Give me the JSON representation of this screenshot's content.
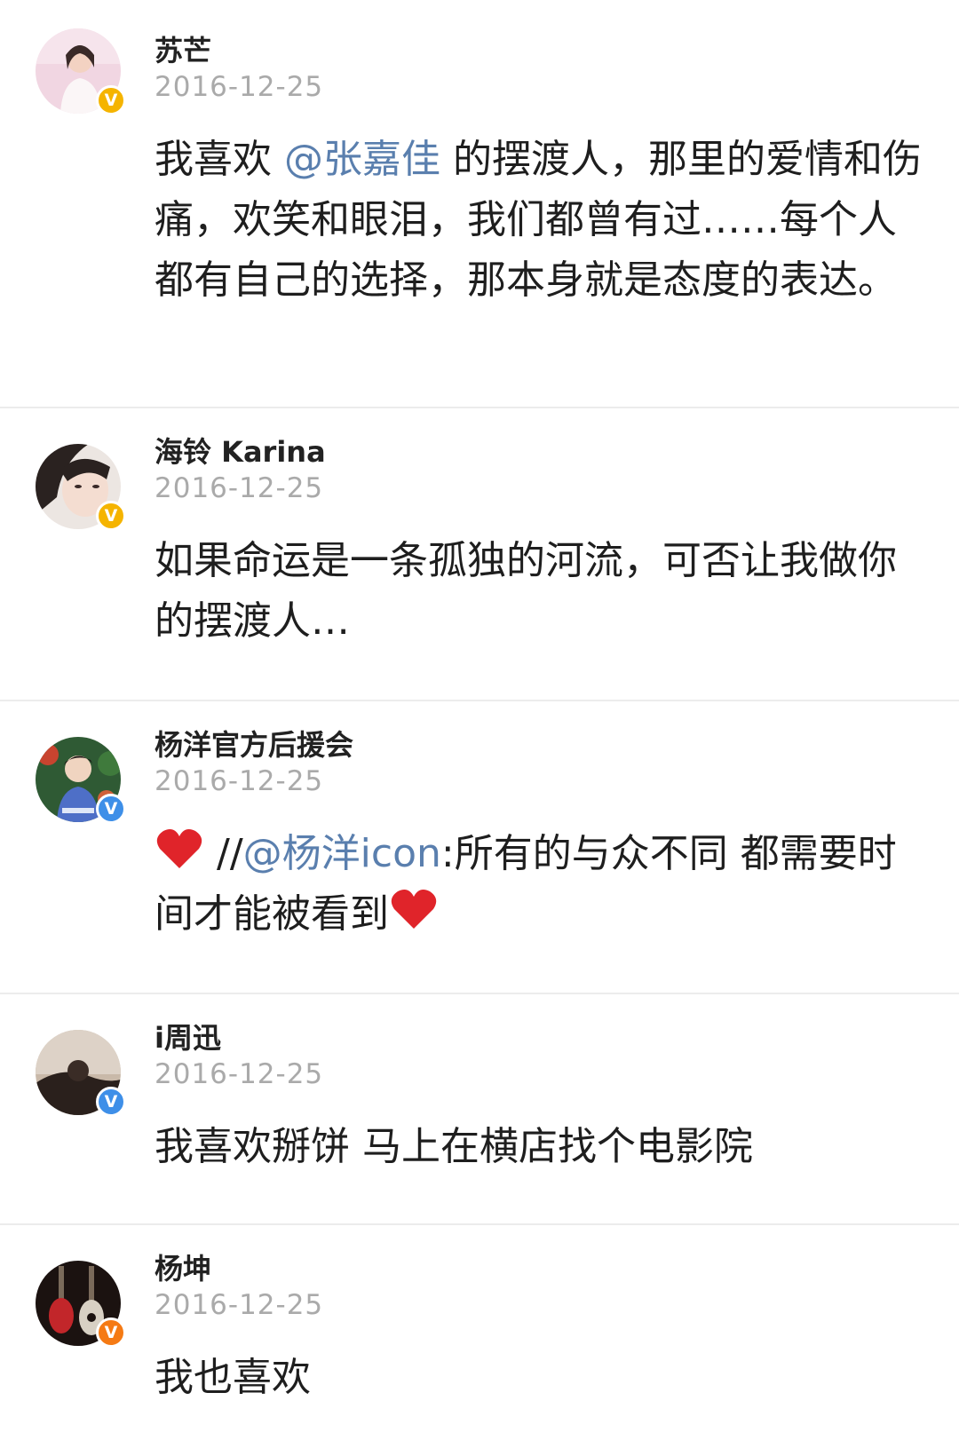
{
  "posts": [
    {
      "username": "苏芒",
      "date": "2016-12-25",
      "badge": "V",
      "badge_color": "#f5b400",
      "avatar_icon": "woman-white-dress-avatar",
      "content_before": "我喜欢 ",
      "mention": "@张嘉佳",
      "content_after": " 的摆渡人，那里的爱情和伤痛，欢笑和眼泪，我们都曾有过……每个人都有自己的选择，那本身就是态度的表达。"
    },
    {
      "username": "海铃 Karina",
      "date": "2016-12-25",
      "badge": "V",
      "badge_color": "#f5b400",
      "avatar_icon": "woman-portrait-avatar",
      "content": "如果命运是一条孤独的河流，可否让我做你的摆渡人…"
    },
    {
      "username": "杨洋官方后援会",
      "date": "2016-12-25",
      "badge": "V",
      "badge_color": "#3e8fe8",
      "avatar_icon": "young-man-foliage-avatar",
      "prefix": "//",
      "mention": "@杨洋icon",
      "content": ":所有的与众不同 都需要时间才能被看到",
      "emoji": "red-heart-icon"
    },
    {
      "username": "i周迅",
      "date": "2016-12-25",
      "badge": "V",
      "badge_color": "#3e8fe8",
      "avatar_icon": "silhouette-avatar",
      "content": "我喜欢掰饼 马上在横店找个电影院"
    },
    {
      "username": "杨坤",
      "date": "2016-12-25",
      "badge": "V",
      "badge_color": "#f57a14",
      "avatar_icon": "guitars-avatar",
      "content": "我也喜欢"
    }
  ]
}
